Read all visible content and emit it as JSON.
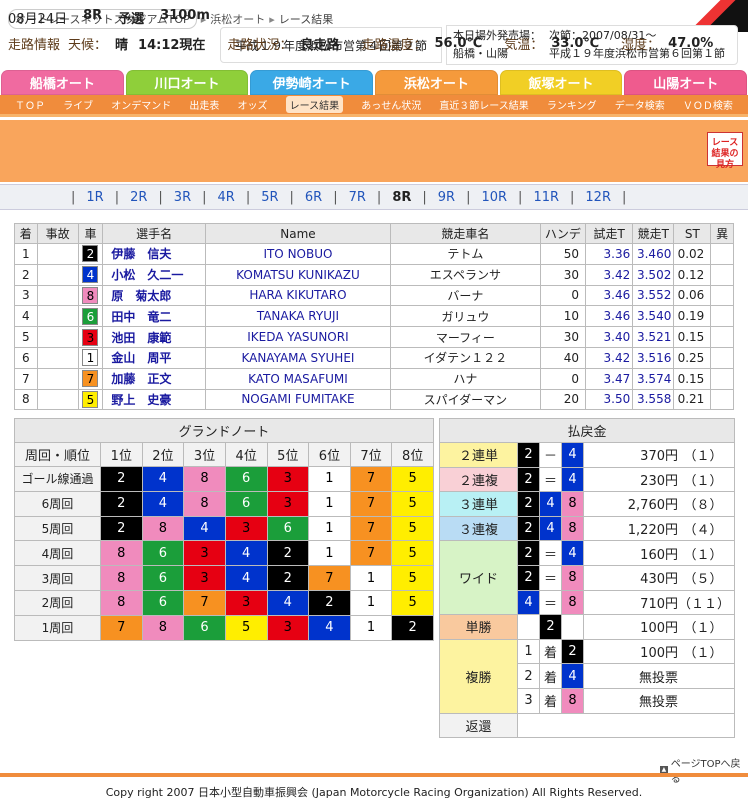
{
  "breadcrumb": [
    "オートレースネットスタジアムTOP",
    "浜松オート",
    "レース結果"
  ],
  "title": "平成１９年度浜松市営第４回第２節",
  "info": {
    "outside_label": "本日場外発売場：",
    "outside_value": "船橋・山陽",
    "next_label": "次節：2007/08/31～",
    "next_value": "平成１９年度浜松市営第６回第１節"
  },
  "tracks": [
    {
      "label": "船橋オート",
      "color": "#f06aa0"
    },
    {
      "label": "川口オート",
      "color": "#8fcf3a"
    },
    {
      "label": "伊勢崎オート",
      "color": "#3aa9e6"
    },
    {
      "label": "浜松オート",
      "color": "#f59a3c"
    },
    {
      "label": "飯塚オート",
      "color": "#f1cf25"
    },
    {
      "label": "山陽オート",
      "color": "#ef5b8e"
    }
  ],
  "nav": [
    "ＴＯＰ",
    "ライブ",
    "オンデマンド",
    "出走表",
    "オッズ",
    "レース結果",
    "あっせん状況",
    "直近３節レース結果",
    "ランキング",
    "データ検索",
    "ＶＯＤ検索"
  ],
  "nav_active": 5,
  "race": {
    "date": "08月24日",
    "race_no": "8R",
    "type": "予選",
    "distance": "3100m",
    "info_label": "走路情報",
    "weather_label": "天候：",
    "weather": "晴",
    "time": "14:12現在",
    "track_label": "走路状況：",
    "track": "良走路",
    "track_temp_label": "走路温度：",
    "track_temp": "56.0℃",
    "temp_label": "気温：",
    "temp": "33.0℃",
    "humidity_label": "湿度：",
    "humidity": "47.0%"
  },
  "guide_button": "レース結果の見方",
  "races": [
    "1R",
    "2R",
    "3R",
    "4R",
    "5R",
    "6R",
    "7R",
    "8R",
    "9R",
    "10R",
    "11R",
    "12R"
  ],
  "race_active": 7,
  "car_colors": {
    "1": {
      "bg": "#ffffff",
      "fg": "#000000"
    },
    "2": {
      "bg": "#000000",
      "fg": "#ffffff"
    },
    "3": {
      "bg": "#e60012",
      "fg": "#000000"
    },
    "4": {
      "bg": "#0033cc",
      "fg": "#ffffff"
    },
    "5": {
      "bg": "#ffee00",
      "fg": "#000000"
    },
    "6": {
      "bg": "#1b9e3a",
      "fg": "#ffffff"
    },
    "7": {
      "bg": "#f79121",
      "fg": "#000000"
    },
    "8": {
      "bg": "#f08bbd",
      "fg": "#000000"
    }
  },
  "entries_headers": [
    "着",
    "事故",
    "車",
    "選手名",
    "Name",
    "競走車名",
    "ハンデ",
    "試走T",
    "競走T",
    "ST",
    "異"
  ],
  "entries": [
    {
      "rank": "1",
      "acc": "",
      "car": "2",
      "name": "伊藤　信夫",
      "en": "ITO NOBUO",
      "bike": "テトム",
      "handi": "50",
      "trial": "3.36",
      "race": "3.460",
      "st": "0.02",
      "ab": ""
    },
    {
      "rank": "2",
      "acc": "",
      "car": "4",
      "name": "小松　久二一",
      "en": "KOMATSU KUNIKAZU",
      "bike": "エスペランサ",
      "handi": "30",
      "trial": "3.42",
      "race": "3.502",
      "st": "0.12",
      "ab": ""
    },
    {
      "rank": "3",
      "acc": "",
      "car": "8",
      "name": "原　菊太郎",
      "en": "HARA KIKUTARO",
      "bike": "バーナ",
      "handi": "0",
      "trial": "3.46",
      "race": "3.552",
      "st": "0.06",
      "ab": ""
    },
    {
      "rank": "4",
      "acc": "",
      "car": "6",
      "name": "田中　竜二",
      "en": "TANAKA RYUJI",
      "bike": "ガリュウ",
      "handi": "10",
      "trial": "3.46",
      "race": "3.540",
      "st": "0.19",
      "ab": ""
    },
    {
      "rank": "5",
      "acc": "",
      "car": "3",
      "name": "池田　康範",
      "en": "IKEDA YASUNORI",
      "bike": "マーフィー",
      "handi": "30",
      "trial": "3.40",
      "race": "3.521",
      "st": "0.15",
      "ab": ""
    },
    {
      "rank": "6",
      "acc": "",
      "car": "1",
      "name": "金山　周平",
      "en": "KANAYAMA SYUHEI",
      "bike": "イダテン１２２",
      "handi": "40",
      "trial": "3.42",
      "race": "3.516",
      "st": "0.25",
      "ab": ""
    },
    {
      "rank": "7",
      "acc": "",
      "car": "7",
      "name": "加藤　正文",
      "en": "KATO MASAFUMI",
      "bike": "ハナ",
      "handi": "0",
      "trial": "3.47",
      "race": "3.574",
      "st": "0.15",
      "ab": ""
    },
    {
      "rank": "8",
      "acc": "",
      "car": "5",
      "name": "野上　史豪",
      "en": "NOGAMI FUMITAKE",
      "bike": "スパイダーマン",
      "handi": "20",
      "trial": "3.50",
      "race": "3.558",
      "st": "0.21",
      "ab": ""
    }
  ],
  "grand_note": {
    "title": "グランドノート",
    "corner_label": "周回・順位",
    "positions": [
      "1位",
      "2位",
      "3位",
      "4位",
      "5位",
      "6位",
      "7位",
      "8位"
    ],
    "rows": [
      {
        "label": "ゴール線通過",
        "cars": [
          "2",
          "4",
          "8",
          "6",
          "3",
          "1",
          "7",
          "5"
        ]
      },
      {
        "label": "6周回",
        "cars": [
          "2",
          "4",
          "8",
          "6",
          "3",
          "1",
          "7",
          "5"
        ]
      },
      {
        "label": "5周回",
        "cars": [
          "2",
          "8",
          "4",
          "3",
          "6",
          "1",
          "7",
          "5"
        ]
      },
      {
        "label": "4周回",
        "cars": [
          "8",
          "6",
          "3",
          "4",
          "2",
          "1",
          "7",
          "5"
        ]
      },
      {
        "label": "3周回",
        "cars": [
          "8",
          "6",
          "3",
          "4",
          "2",
          "7",
          "1",
          "5"
        ]
      },
      {
        "label": "2周回",
        "cars": [
          "8",
          "6",
          "7",
          "3",
          "4",
          "2",
          "1",
          "5"
        ]
      },
      {
        "label": "1周回",
        "cars": [
          "7",
          "8",
          "6",
          "5",
          "3",
          "4",
          "1",
          "2"
        ]
      }
    ]
  },
  "payout": {
    "title": "払戻金",
    "rentan2": {
      "label": "２連単",
      "cars": [
        "2",
        "4"
      ],
      "sep": "－",
      "amount": "370円",
      "pop": "（１）"
    },
    "renfuku2": {
      "label": "２連複",
      "cars": [
        "2",
        "4"
      ],
      "sep": "＝",
      "amount": "230円",
      "pop": "（１）"
    },
    "rentan3": {
      "label": "３連単",
      "cars": [
        "2",
        "4",
        "8"
      ],
      "amount": "2,760円",
      "pop": "（８）"
    },
    "renfuku3": {
      "label": "３連複",
      "cars": [
        "2",
        "4",
        "8"
      ],
      "amount": "1,220円",
      "pop": "（４）"
    },
    "wide_label": "ワイド",
    "wide": [
      {
        "cars": [
          "2",
          "4"
        ],
        "sep": "＝",
        "amount": "160円",
        "pop": "（１）"
      },
      {
        "cars": [
          "2",
          "8"
        ],
        "sep": "＝",
        "amount": "430円",
        "pop": "（５）"
      },
      {
        "cars": [
          "4",
          "8"
        ],
        "sep": "＝",
        "amount": "710円",
        "pop": "（１１）"
      }
    ],
    "tansho": {
      "label": "単勝",
      "car": "2",
      "amount": "100円",
      "pop": "（１）"
    },
    "fukusho_label": "複勝",
    "chaku": "着",
    "fukusho": [
      {
        "place": "1",
        "car": "2",
        "amount": "100円",
        "pop": "（１）"
      },
      {
        "place": "2",
        "car": "4",
        "amount": "無投票",
        "pop": ""
      },
      {
        "place": "3",
        "car": "8",
        "amount": "無投票",
        "pop": ""
      }
    ],
    "refund_label": "返還",
    "refund_value": ""
  },
  "page_top": "ページTOPへ戻る",
  "footer": "Copy right 2007 日本小型自動車振興会 (Japan Motorcycle Racing Organization) All Rights Reserved."
}
